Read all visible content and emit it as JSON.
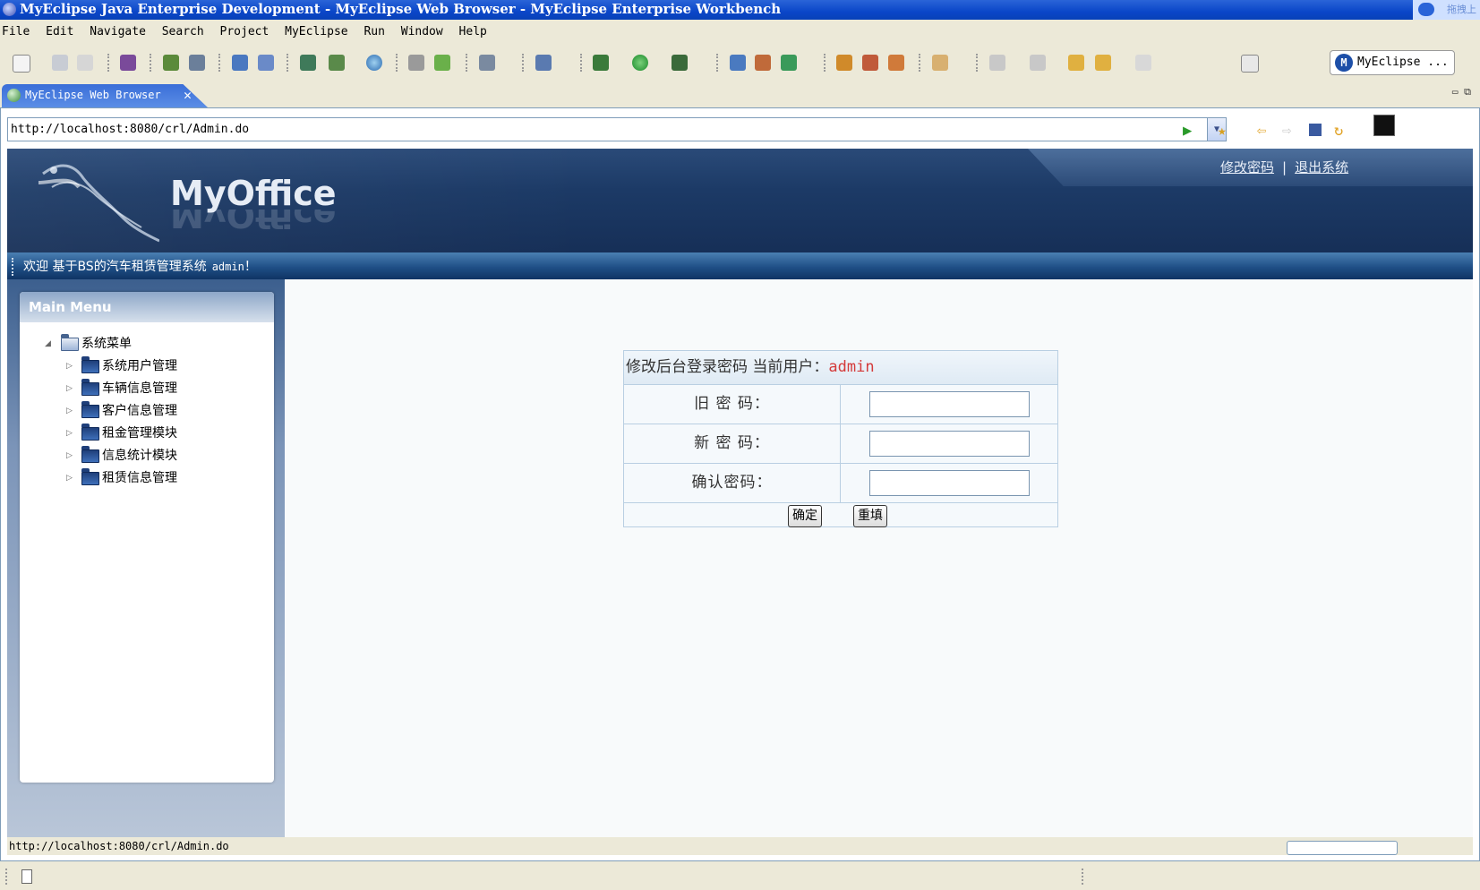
{
  "window": {
    "title": "MyEclipse Java Enterprise Development - MyEclipse Web Browser - MyEclipse Enterprise Workbench",
    "right_corner_text": "拖拽上"
  },
  "menubar": {
    "items": [
      "File",
      "Edit",
      "Navigate",
      "Search",
      "Project",
      "MyEclipse",
      "Run",
      "Window",
      "Help"
    ]
  },
  "toolbar": {
    "perspective_label": "MyEclipse ..."
  },
  "editor_tab": {
    "label": "MyEclipse Web Browser"
  },
  "browser": {
    "url": "http://localhost:8080/crl/Admin.do",
    "status_url": "http://localhost:8080/crl/Admin.do"
  },
  "page": {
    "logo": "MyOffice",
    "top_links": [
      "修改密码",
      "退出系统"
    ],
    "welcome_prefix": "欢迎 基于BS的汽车租赁管理系统",
    "welcome_user": "admin",
    "welcome_suffix": "！",
    "sidebar": {
      "title": "Main Menu",
      "root": "系统菜单",
      "items": [
        "系统用户管理",
        "车辆信息管理",
        "客户信息管理",
        "租金管理模块",
        "信息统计模块",
        "租赁信息管理"
      ]
    },
    "form": {
      "heading": "修改后台登录密码 当前用户：",
      "current_user": "admin",
      "old_password_label": "旧 密 码：",
      "new_password_label": "新 密 码：",
      "confirm_password_label": "确认密码：",
      "submit_label": "确定",
      "reset_label": "重填"
    }
  },
  "colors": {
    "title_bar": "#0a46c8",
    "banner": "#1c3a66",
    "current_user": "#d43a3a"
  }
}
